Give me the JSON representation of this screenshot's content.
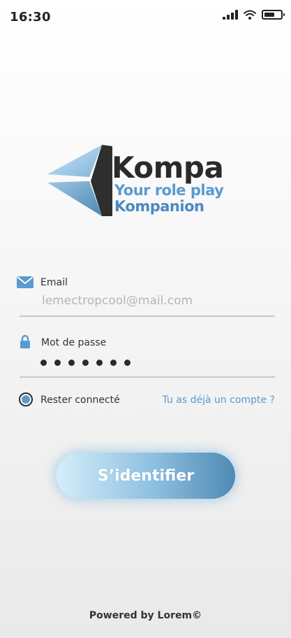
{
  "status_bar": {
    "time": "16:30",
    "icons": [
      "signal-icon",
      "wifi-icon",
      "battery-icon"
    ]
  },
  "logo": {
    "name": "Kompa",
    "tagline_line1": "Your role play",
    "tagline_line2": "Kompanion"
  },
  "form": {
    "email": {
      "label": "Email",
      "value": "lemectropcool@mail.com",
      "icon": "envelope-icon"
    },
    "password": {
      "label": "Mot de passe",
      "masked_length": 7,
      "icon": "lock-icon"
    },
    "remember_label": "Rester connecté",
    "have_account_link": "Tu as déjà un compte ?"
  },
  "login_button": {
    "label": "S’identifier"
  },
  "footer": {
    "powered_by": "Powered by Lorem©"
  },
  "colors": {
    "accent": "#5a9ad0",
    "button_gradient": [
      "#d3eefa",
      "#8dbfe0",
      "#4f89b3"
    ],
    "text_dark": "#2a2a2a"
  }
}
